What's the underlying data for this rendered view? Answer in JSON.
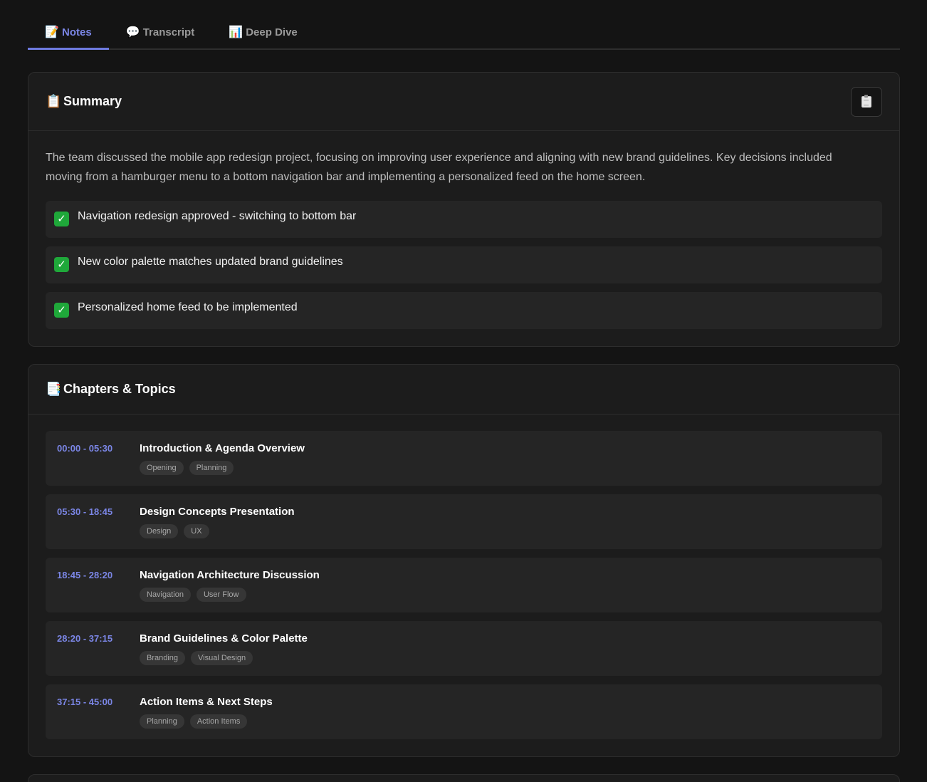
{
  "tabs": [
    {
      "icon": "📝",
      "label": "Notes",
      "active": true
    },
    {
      "icon": "💬",
      "label": "Transcript",
      "active": false
    },
    {
      "icon": "📊",
      "label": "Deep Dive",
      "active": false
    }
  ],
  "summary": {
    "icon": "📋",
    "title": "Summary",
    "copy_icon": "clipboard-icon",
    "text": "The team discussed the mobile app redesign project, focusing on improving user experience and aligning with new brand guidelines. Key decisions included moving from a hamburger menu to a bottom navigation bar and implementing a personalized feed on the home screen.",
    "key_points": [
      {
        "icon": "✓",
        "text": "Navigation redesign approved - switching to bottom bar"
      },
      {
        "icon": "✓",
        "text": "New color palette matches updated brand guidelines"
      },
      {
        "icon": "✓",
        "text": "Personalized home feed to be implemented"
      }
    ]
  },
  "chapters": {
    "icon": "📑",
    "title": "Chapters & Topics",
    "items": [
      {
        "time": "00:00 - 05:30",
        "title": "Introduction & Agenda Overview",
        "tags": [
          "Opening",
          "Planning"
        ]
      },
      {
        "time": "05:30 - 18:45",
        "title": "Design Concepts Presentation",
        "tags": [
          "Design",
          "UX"
        ]
      },
      {
        "time": "18:45 - 28:20",
        "title": "Navigation Architecture Discussion",
        "tags": [
          "Navigation",
          "User Flow"
        ]
      },
      {
        "time": "28:20 - 37:15",
        "title": "Brand Guidelines & Color Palette",
        "tags": [
          "Branding",
          "Visual Design"
        ]
      },
      {
        "time": "37:15 - 45:00",
        "title": "Action Items & Next Steps",
        "tags": [
          "Planning",
          "Action Items"
        ]
      }
    ]
  },
  "colors": {
    "background": "#141414",
    "card": "#1c1c1c",
    "accent": "#7b86e6",
    "check": "#1fa83a"
  }
}
